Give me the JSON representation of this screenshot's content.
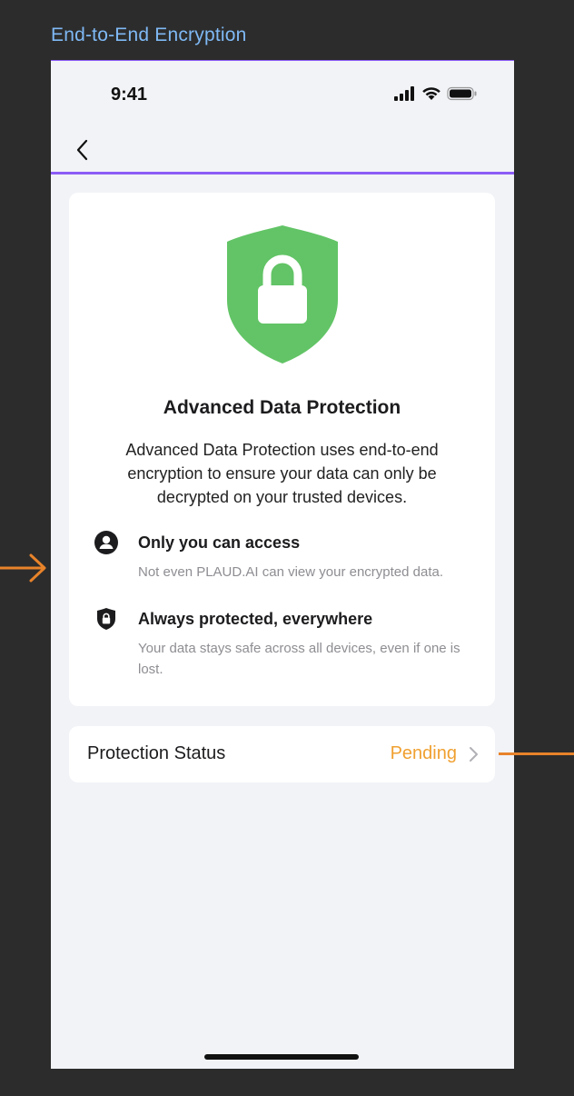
{
  "frame": {
    "label": "End-to-End Encryption"
  },
  "status_bar": {
    "time": "9:41",
    "icons": [
      "cellular-signal-icon",
      "wifi-icon",
      "battery-icon"
    ]
  },
  "navbar": {
    "back_icon": "chevron-left-icon"
  },
  "card": {
    "shield_icon": "lock-shield-icon",
    "shield_color": "#62c466",
    "title": "Advanced Data Protection",
    "description": "Advanced Data Protection uses end-to-end encryption to ensure your data can only be decrypted on your trusted devices.",
    "features": [
      {
        "icon": "person-circle-icon",
        "title": "Only you can access",
        "description": "Not even PLAUD.AI can view your encrypted data."
      },
      {
        "icon": "shield-lock-icon",
        "title": "Always protected, everywhere",
        "description": "Your data stays safe across all devices, even if one is lost."
      }
    ]
  },
  "protection_status": {
    "label": "Protection Status",
    "value": "Pending",
    "value_color": "#f0a030"
  },
  "colors": {
    "accent_annotation": "#e8832a",
    "selection_outline": "#8b5cf6",
    "frame_label": "#7fb9f5"
  }
}
